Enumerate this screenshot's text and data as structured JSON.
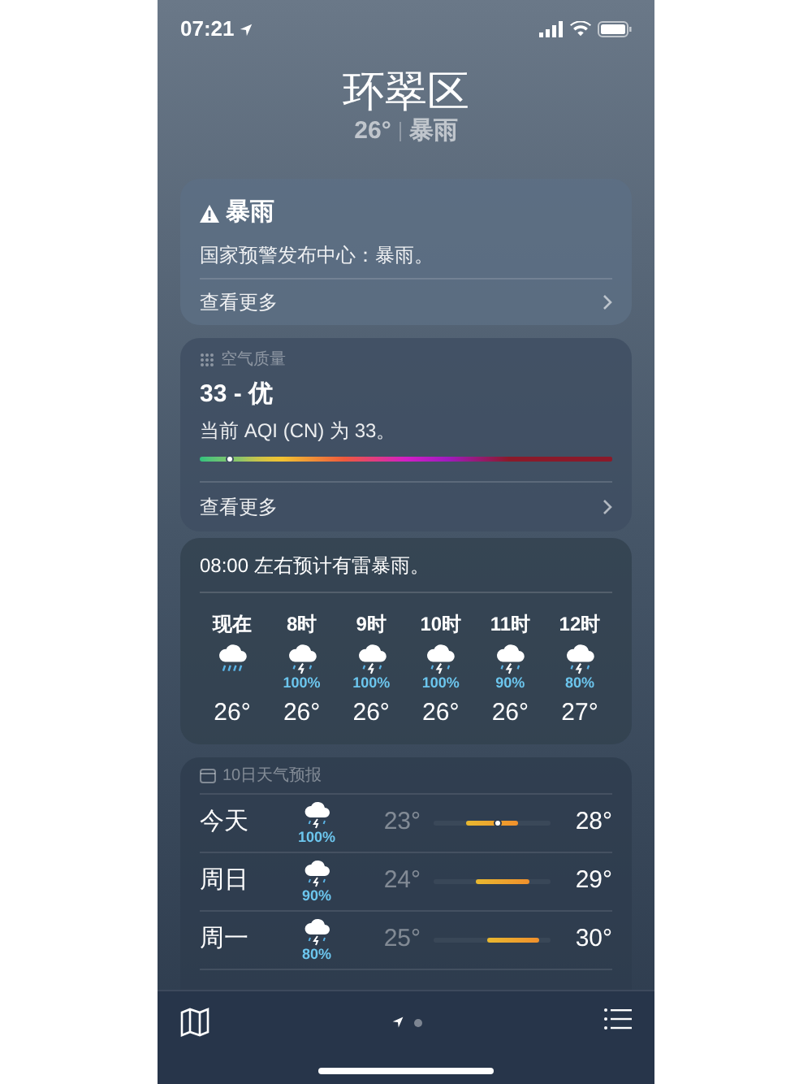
{
  "status_bar": {
    "time": "07:21"
  },
  "location": {
    "name": "环翠区",
    "temperature": "26°",
    "condition": "暴雨"
  },
  "alert": {
    "title": "暴雨",
    "text": "国家预警发布中心：暴雨。",
    "more": "查看更多"
  },
  "air_quality": {
    "label": "空气质量",
    "value": "33 - 优",
    "text": "当前 AQI (CN) 为 33。",
    "level": 0.07,
    "more": "查看更多"
  },
  "hourly": {
    "summary": "08:00 左右预计有雷暴雨。",
    "hours": [
      {
        "time": "现在",
        "kind": "rain",
        "temperature": "26°"
      },
      {
        "time": "8时",
        "kind": "thunderstorm",
        "chance": "100%",
        "temperature": "26°"
      },
      {
        "time": "9时",
        "kind": "thunderstorm",
        "chance": "100%",
        "temperature": "26°"
      },
      {
        "time": "10时",
        "kind": "thunderstorm",
        "chance": "100%",
        "temperature": "26°"
      },
      {
        "time": "11时",
        "kind": "thunderstorm",
        "chance": "90%",
        "temperature": "26°"
      },
      {
        "time": "12时",
        "kind": "thunderstorm",
        "chance": "80%",
        "temperature": "27°"
      }
    ]
  },
  "forecast": {
    "title": "10日天气预报",
    "days": [
      {
        "day": "今天",
        "kind": "thunderstorm",
        "chance": "100%",
        "low": "23°",
        "high": "28°",
        "current_marker": true
      },
      {
        "day": "周日",
        "kind": "thunderstorm",
        "chance": "90%",
        "low": "24°",
        "high": "29°",
        "current_marker": false
      },
      {
        "day": "周一",
        "kind": "thunderstorm",
        "chance": "80%",
        "low": "25°",
        "high": "30°",
        "current_marker": false
      }
    ]
  }
}
